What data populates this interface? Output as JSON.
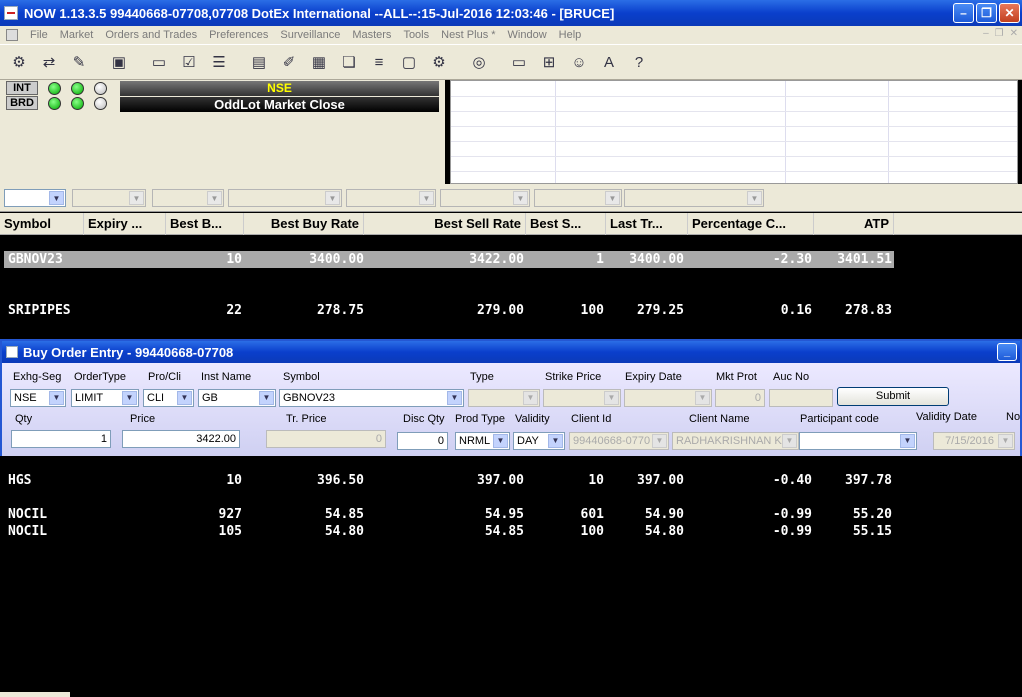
{
  "window": {
    "title": "NOW 1.13.3.5 99440668-07708,07708 DotEx International --ALL--:15-Jul-2016 12:03:46 - [BRUCE]"
  },
  "menu": [
    "File",
    "Market",
    "Orders and Trades",
    "Preferences",
    "Surveillance",
    "Masters",
    "Tools",
    "Nest Plus *",
    "Window",
    "Help"
  ],
  "status": {
    "int_label": "INT",
    "brd_label": "BRD",
    "exchange": "NSE",
    "market_status": "OddLot Market Close"
  },
  "market_watch": {
    "columns": [
      "Symbol",
      "Expiry ...",
      "Best B...",
      "Best Buy Rate",
      "Best Sell Rate",
      "Best S...",
      "Last Tr...",
      "Percentage C...",
      "ATP"
    ],
    "rows_top": [
      {
        "symbol": "GBNOV23",
        "best_buy_qty": "10",
        "best_buy_rate": "3400.00",
        "best_sell_rate": "3422.00",
        "best_sell_qty": "1",
        "last_traded": "3400.00",
        "pct_change": "-2.30",
        "atp": "3401.51"
      },
      {
        "symbol": "SRIPIPES",
        "best_buy_qty": "22",
        "best_buy_rate": "278.75",
        "best_sell_rate": "279.00",
        "best_sell_qty": "100",
        "last_traded": "279.25",
        "pct_change": "0.16",
        "atp": "278.83"
      }
    ],
    "rows_bottom": [
      {
        "symbol": "HGS",
        "best_buy_qty": "10",
        "best_buy_rate": "396.50",
        "best_sell_rate": "397.00",
        "best_sell_qty": "10",
        "last_traded": "397.00",
        "pct_change": "-0.40",
        "atp": "397.78"
      },
      {
        "symbol": "NOCIL",
        "best_buy_qty": "927",
        "best_buy_rate": "54.85",
        "best_sell_rate": "54.95",
        "best_sell_qty": "601",
        "last_traded": "54.90",
        "pct_change": "-0.99",
        "atp": "55.20"
      },
      {
        "symbol": "NOCIL",
        "best_buy_qty": "105",
        "best_buy_rate": "54.80",
        "best_sell_rate": "54.85",
        "best_sell_qty": "100",
        "last_traded": "54.80",
        "pct_change": "-0.99",
        "atp": "55.15"
      }
    ]
  },
  "order_entry": {
    "title": "Buy Order Entry - 99440668-07708",
    "labels": {
      "exchg_seg": "Exhg-Seg",
      "order_type": "OrderType",
      "pro_cli": "Pro/Cli",
      "inst_name": "Inst Name",
      "symbol": "Symbol",
      "type": "Type",
      "strike_price": "Strike Price",
      "expiry_date": "Expiry Date",
      "mkt_prot": "Mkt Prot",
      "auc_no": "Auc No",
      "qty": "Qty",
      "price": "Price",
      "tr_price": "Tr. Price",
      "disc_qty": "Disc Qty",
      "prod_type": "Prod Type",
      "validity": "Validity",
      "client_id": "Client Id",
      "client_name": "Client Name",
      "participant_code": "Participant code",
      "validity_date": "Validity Date",
      "no": "No o"
    },
    "values": {
      "exchg_seg": "NSE",
      "order_type": "LIMIT",
      "pro_cli": "CLI",
      "inst_name": "GB",
      "symbol": "GBNOV23",
      "mkt_prot": "0",
      "qty": "1",
      "price": "3422.00",
      "tr_price": "0",
      "disc_qty": "0",
      "prod_type": "NRML",
      "validity": "DAY",
      "client_id": "99440668-0770",
      "client_name": "RADHAKRISHNAN KAR",
      "validity_date": "7/15/2016"
    },
    "submit_label": "Submit"
  }
}
